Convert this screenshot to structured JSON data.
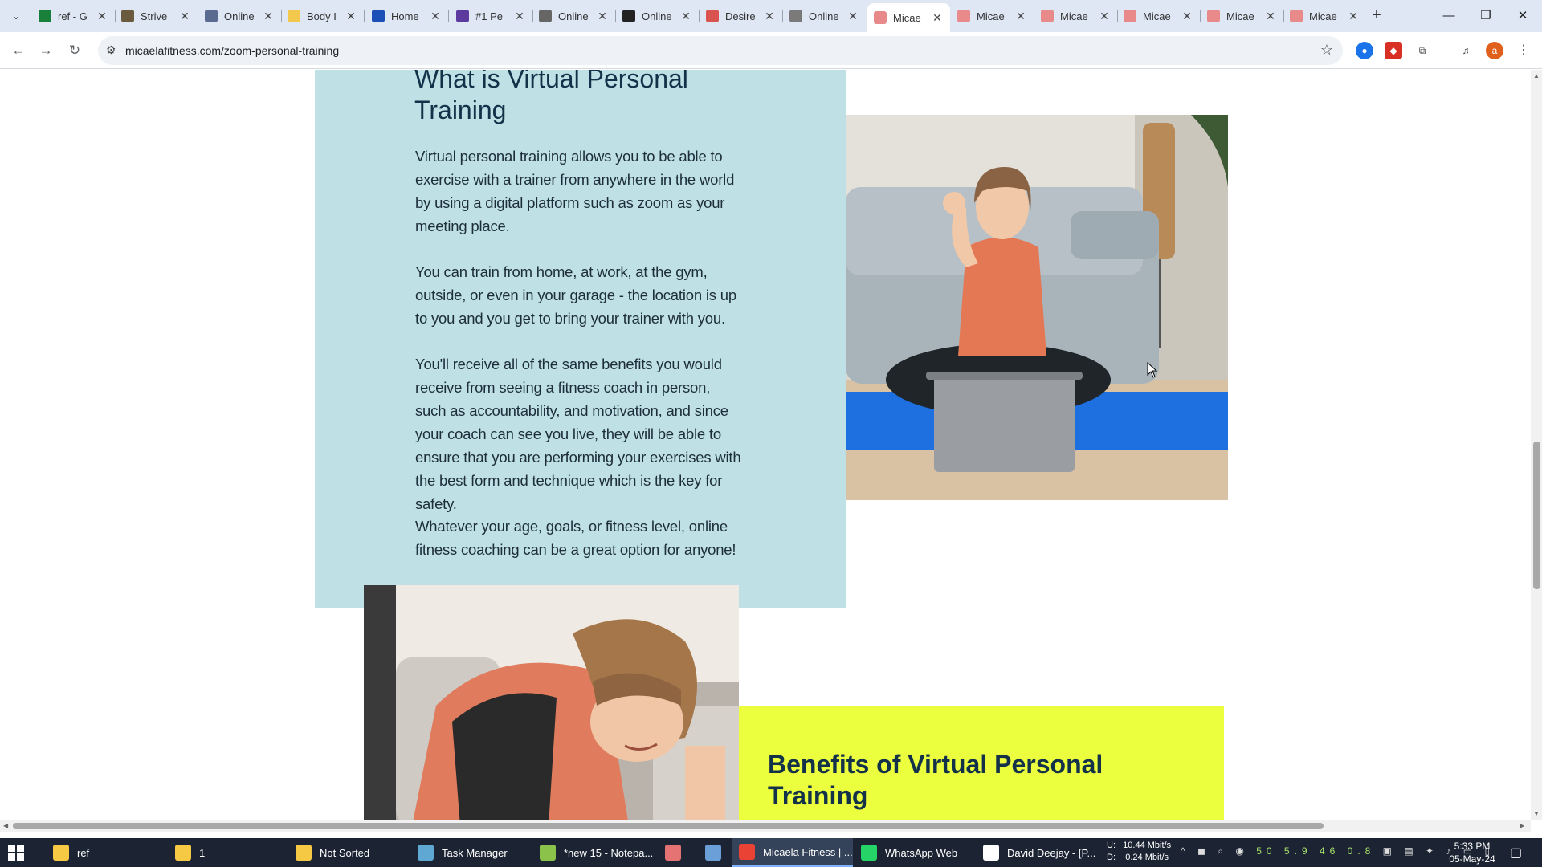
{
  "browser": {
    "url": "micaelafitness.com/zoom-personal-training",
    "tabs": [
      {
        "label": "ref - G",
        "color": "#188038"
      },
      {
        "label": "Strive",
        "color": "#6b5b3e"
      },
      {
        "label": "Online",
        "color": "#5b6a91"
      },
      {
        "label": "Body I",
        "color": "#f2c94c"
      },
      {
        "label": "Home",
        "color": "#1a4fb6"
      },
      {
        "label": "#1 Pe",
        "color": "#5c3a9e"
      },
      {
        "label": "Online",
        "color": "#666666"
      },
      {
        "label": "Online",
        "color": "#222222"
      },
      {
        "label": "Desire",
        "color": "#d9534f"
      },
      {
        "label": "Online",
        "color": "#7a7a7a"
      },
      {
        "label": "Micae",
        "color": "#e88a8a"
      },
      {
        "label": "Micae",
        "color": "#e88a8a"
      },
      {
        "label": "Micae",
        "color": "#e88a8a"
      },
      {
        "label": "Micae",
        "color": "#e88a8a"
      },
      {
        "label": "Micae",
        "color": "#e88a8a"
      },
      {
        "label": "Micae",
        "color": "#e88a8a"
      }
    ],
    "active_tab_index": 10,
    "profile_initial": "a"
  },
  "page": {
    "section1_heading": "What is Virtual Personal Training",
    "paragraphs": [
      "Virtual personal training allows you to be able to exercise with a trainer from anywhere in the world by using a digital platform such as zoom as your meeting place.",
      "You can train from home, at work, at the gym, outside, or even in your garage - the location is up to you and you get to bring your trainer with you.",
      "You'll receive all of the same benefits you would receive from seeing a fitness coach in person, such as accountability, and motivation, and since your coach can see you live, they will be able to ensure that you are performing your exercises with the best form and technique which is the key for safety.",
      "Whatever your age, goals, or fitness level, online fitness coaching can be a great option for anyone!"
    ],
    "section2_heading": "Benefits of Virtual Personal Training",
    "colors": {
      "panel_blue": "#bfe0e4",
      "panel_yellow": "#ecff3f",
      "heading": "#13324a"
    }
  },
  "taskbar": {
    "items": [
      {
        "label": "ref",
        "icon": "folder-icon",
        "color": "#f6c945"
      },
      {
        "label": "1",
        "icon": "folder-icon",
        "color": "#f6c945"
      },
      {
        "label": "Not Sorted",
        "icon": "folder-icon",
        "color": "#f6c945"
      },
      {
        "label": "Task Manager",
        "icon": "task-manager-icon",
        "color": "#5fa8d3"
      },
      {
        "label": "*new 15 - Notepa...",
        "icon": "notepad-icon",
        "color": "#8bc34a"
      },
      {
        "label": "",
        "icon": "app-icon",
        "color": "#e57373"
      },
      {
        "label": "",
        "icon": "document-icon",
        "color": "#6a9fd8"
      },
      {
        "label": "Micaela Fitness | ...",
        "icon": "chrome-icon",
        "color": "#ea4335"
      },
      {
        "label": "WhatsApp Web",
        "icon": "whatsapp-icon",
        "color": "#25d366"
      },
      {
        "label": "David Deejay - [P...",
        "icon": "app-icon",
        "color": "#ffffff"
      }
    ],
    "net_up": "10.44 Mbit/s",
    "net_down": "0.24 Mbit/s",
    "net_up_label": "U:",
    "net_down_label": "D:",
    "tray_values": [
      "50",
      "5.9",
      "46",
      "0.8"
    ],
    "time": "5:33 PM",
    "date": "05-May-24"
  }
}
